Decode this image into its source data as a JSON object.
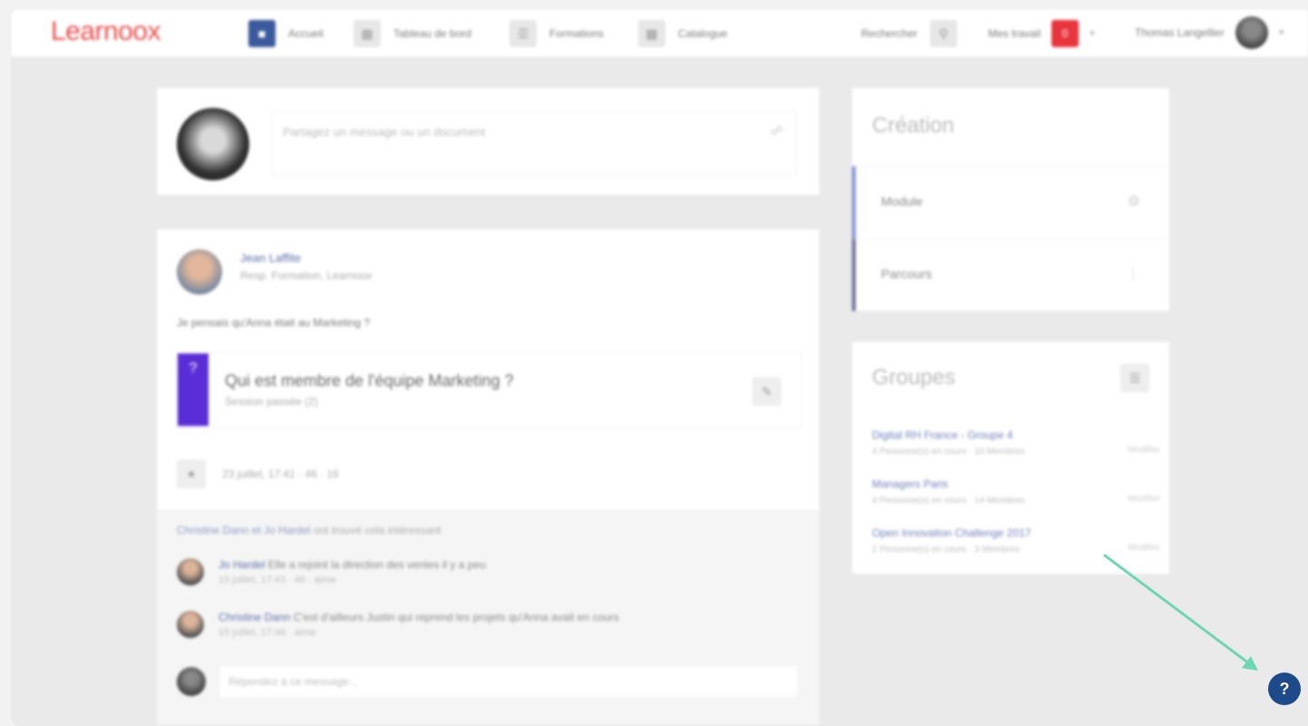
{
  "topbar": {
    "logo": "Learnoox",
    "nav": [
      {
        "label": "Accueil",
        "icon": "home-icon"
      },
      {
        "label": "Tableau de bord",
        "icon": "dashboard-icon"
      },
      {
        "label": "Formations",
        "icon": "book-icon"
      },
      {
        "label": "Catalogue",
        "icon": "catalog-icon"
      }
    ],
    "search_label": "Rechercher",
    "notifications_label": "Mes travail",
    "notifications_count": "0",
    "user_name": "Thomas Langellier"
  },
  "composer": {
    "placeholder": "Partagez un message ou un document"
  },
  "post": {
    "author": "Jean Laffite",
    "role": "Resp. Formation, Learnoox",
    "text": "Je pensais qu'Anna était au Marketing ?",
    "quiz_title": "Qui est membre de l'équipe Marketing ?",
    "quiz_sub": "Session passée (2)",
    "meta": "23 juillet, 17:41 · 46 · 16",
    "likes_names": "Christine Dann et Jo Hardel",
    "likes_suffix": "ont trouvé cela intéressant",
    "comments": [
      {
        "author": "Jo Hardel",
        "text": "Elle a rejoint la direction des ventes il y a peu",
        "meta": "15 juillet, 17:43 · 46 · aime"
      },
      {
        "author": "Christine Dann",
        "text": "C'est d'ailleurs Justin qui reprend les projets qu'Anna avait en cours",
        "meta": "15 juillet, 17:46 · aime"
      }
    ],
    "reply_placeholder": "Répondez à ce message..."
  },
  "creation": {
    "title": "Création",
    "items": [
      "Module",
      "Parcours"
    ]
  },
  "groups": {
    "title": "Groupes",
    "items": [
      {
        "name": "Digital RH France - Groupe 4",
        "stats": "4 Personne(s) en cours · 10 Membres",
        "action": "Modifier"
      },
      {
        "name": "Managers Paris",
        "stats": "4 Personne(s) en cours · 14 Membres",
        "action": "Modifier"
      },
      {
        "name": "Open Innovation Challenge 2017",
        "stats": "1 Personne(s) en cours · 3 Membres",
        "action": "Modifier"
      }
    ]
  },
  "help": {
    "label": "?"
  },
  "colors": {
    "accent": "#3b5a9d",
    "logo": "#e84a4a",
    "badge": "#e8343c",
    "quiz": "#5a2ed6",
    "help": "#1f4a8a",
    "arrow": "#6dd7b4"
  }
}
